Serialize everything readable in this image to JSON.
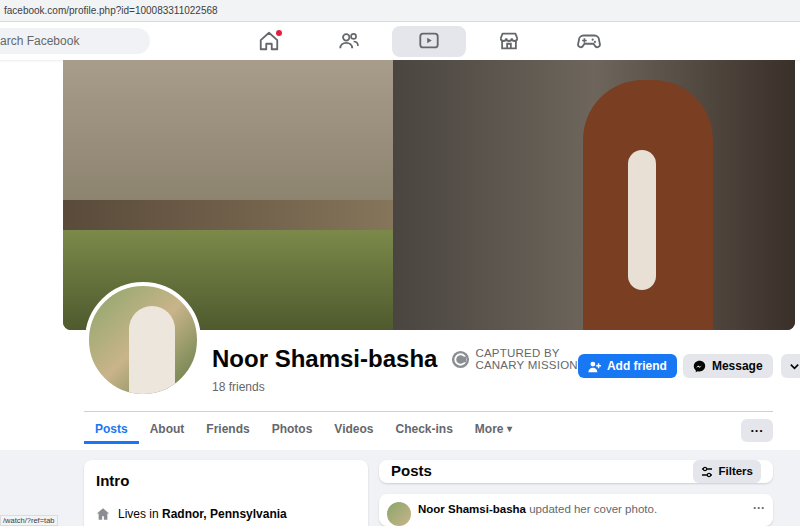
{
  "address_bar": {
    "url": "facebook.com/profile.php?id=100083311022568"
  },
  "search": {
    "placeholder": "arch Facebook"
  },
  "nav": {
    "items": [
      {
        "kind": "home",
        "selected": false,
        "badge": true
      },
      {
        "kind": "friends",
        "selected": false,
        "badge": false
      },
      {
        "kind": "watch",
        "selected": true,
        "badge": false
      },
      {
        "kind": "marketplace",
        "selected": false,
        "badge": false
      },
      {
        "kind": "gaming",
        "selected": false,
        "badge": false
      }
    ]
  },
  "profile": {
    "name": "Noor Shamsi-basha",
    "badge_lines": [
      "CAPTURED BY",
      "CANARY MISSION"
    ],
    "friends": "18 friends"
  },
  "actions": [
    {
      "label": "Add friend",
      "kind": "primary"
    },
    {
      "label": "Message",
      "kind": "secondary"
    }
  ],
  "tabs": [
    {
      "label": "Posts",
      "selected": true,
      "caret": ""
    },
    {
      "label": "About",
      "selected": false,
      "caret": ""
    },
    {
      "label": "Friends",
      "selected": false,
      "caret": ""
    },
    {
      "label": "Photos",
      "selected": false,
      "caret": ""
    },
    {
      "label": "Videos",
      "selected": false,
      "caret": ""
    },
    {
      "label": "Check-ins",
      "selected": false,
      "caret": ""
    },
    {
      "label": "More",
      "selected": false,
      "caret": "▾"
    }
  ],
  "tabs_menu": "···",
  "intro": {
    "title": "Intro",
    "lives_prefix": "Lives in",
    "lives_place": "Radnor, Pennsylvania"
  },
  "posts": {
    "title": "Posts",
    "filters": "Filters"
  },
  "post": {
    "author": "Noor Shamsi-basha",
    "action": "updated her cover photo.",
    "menu": "···"
  },
  "status_bar": "/watch/?ref=tab"
}
